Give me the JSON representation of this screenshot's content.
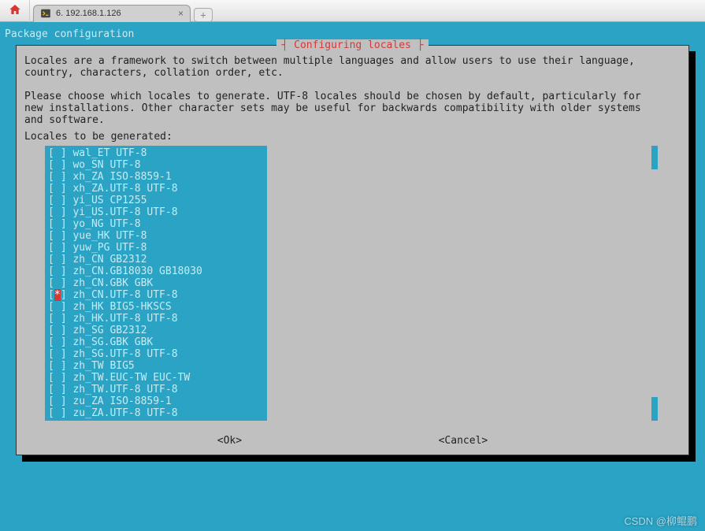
{
  "browser": {
    "tab_title": "6. 192.168.1.126"
  },
  "header": "Package configuration",
  "dialog": {
    "title": "Configuring locales",
    "description": "Locales are a framework to switch between multiple languages and allow users to use their language,\ncountry, characters, collation order, etc.\n\nPlease choose which locales to generate. UTF-8 locales should be chosen by default, particularly for\nnew installations. Other character sets may be useful for backwards compatibility with older systems\nand software.",
    "list_prompt": "Locales to be generated:",
    "items": [
      {
        "label": "wal_ET UTF-8",
        "selected": false
      },
      {
        "label": "wo_SN UTF-8",
        "selected": false
      },
      {
        "label": "xh_ZA ISO-8859-1",
        "selected": false
      },
      {
        "label": "xh_ZA.UTF-8 UTF-8",
        "selected": false
      },
      {
        "label": "yi_US CP1255",
        "selected": false
      },
      {
        "label": "yi_US.UTF-8 UTF-8",
        "selected": false
      },
      {
        "label": "yo_NG UTF-8",
        "selected": false
      },
      {
        "label": "yue_HK UTF-8",
        "selected": false
      },
      {
        "label": "yuw_PG UTF-8",
        "selected": false
      },
      {
        "label": "zh_CN GB2312",
        "selected": false
      },
      {
        "label": "zh_CN.GB18030 GB18030",
        "selected": false
      },
      {
        "label": "zh_CN.GBK GBK",
        "selected": false
      },
      {
        "label": "zh_CN.UTF-8 UTF-8",
        "selected": true
      },
      {
        "label": "zh_HK BIG5-HKSCS",
        "selected": false
      },
      {
        "label": "zh_HK.UTF-8 UTF-8",
        "selected": false
      },
      {
        "label": "zh_SG GB2312",
        "selected": false
      },
      {
        "label": "zh_SG.GBK GBK",
        "selected": false
      },
      {
        "label": "zh_SG.UTF-8 UTF-8",
        "selected": false
      },
      {
        "label": "zh_TW BIG5",
        "selected": false
      },
      {
        "label": "zh_TW.EUC-TW EUC-TW",
        "selected": false
      },
      {
        "label": "zh_TW.UTF-8 UTF-8",
        "selected": false
      },
      {
        "label": "zu_ZA ISO-8859-1",
        "selected": false
      },
      {
        "label": "zu_ZA.UTF-8 UTF-8",
        "selected": false
      }
    ],
    "ok_label": "<Ok>",
    "cancel_label": "<Cancel>"
  },
  "watermark": "CSDN @柳鲲鹏"
}
